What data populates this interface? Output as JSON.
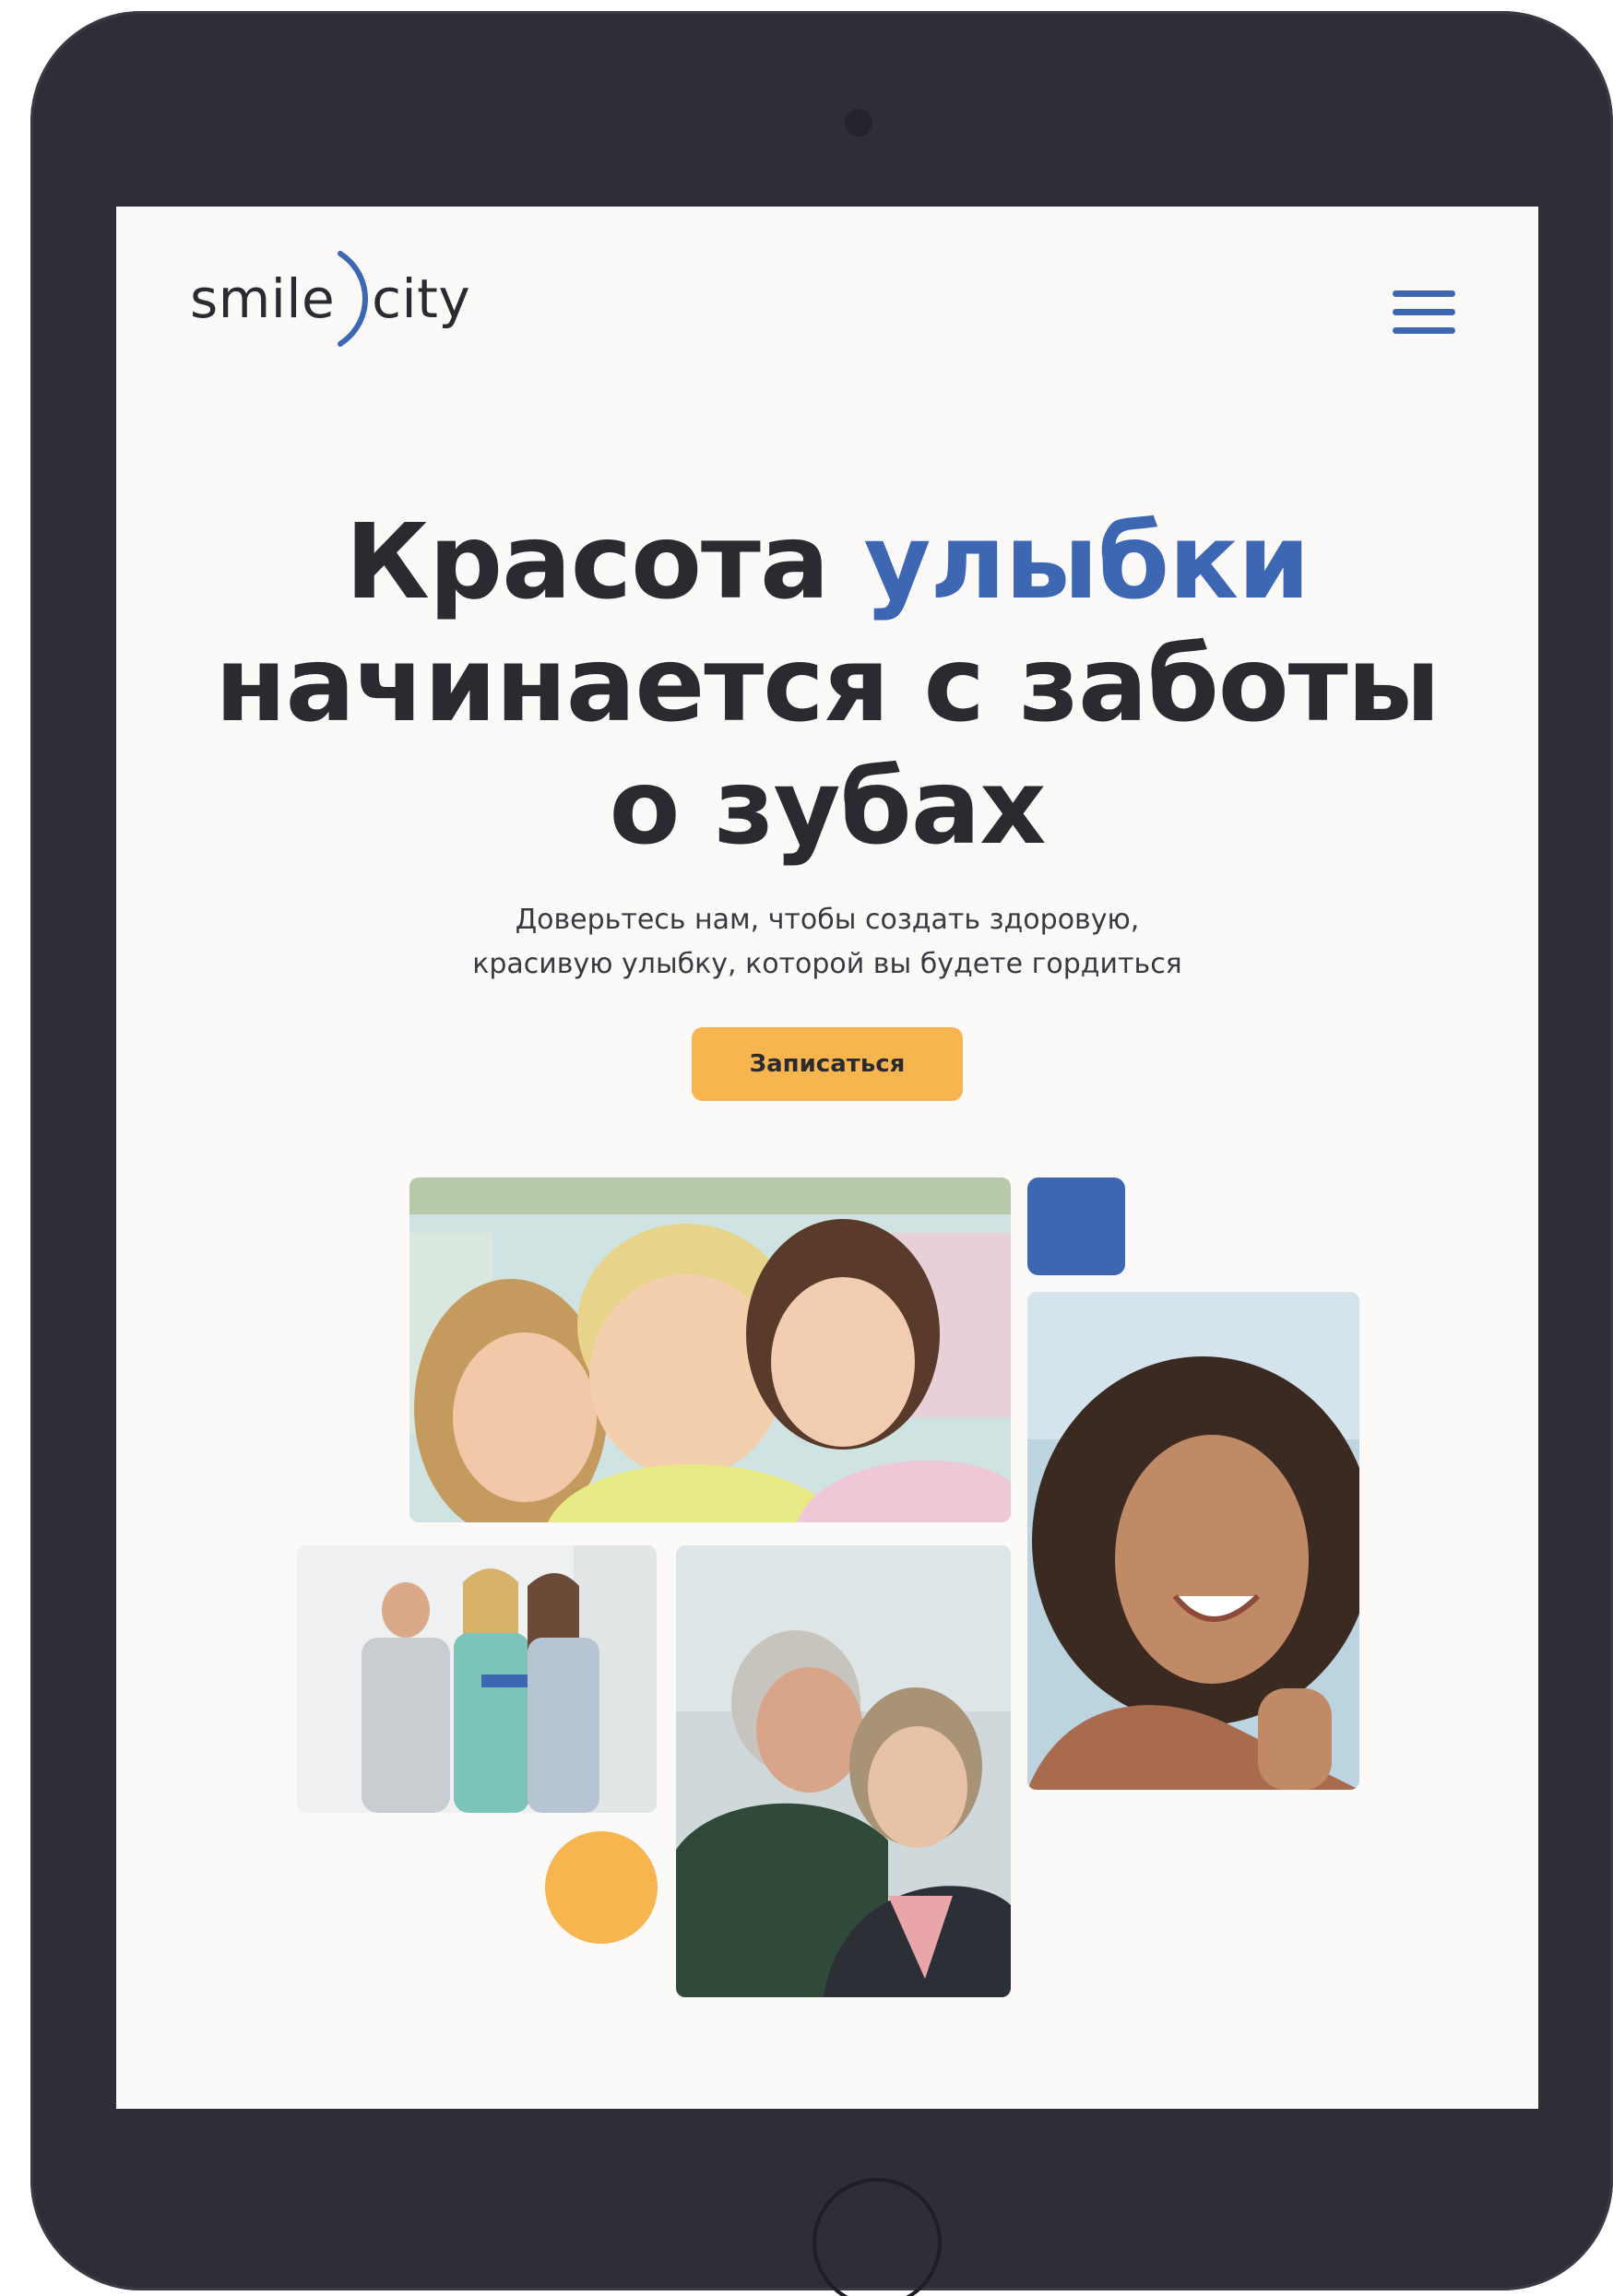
{
  "header": {
    "logo_left": "smile",
    "logo_right": "city",
    "menu_icon": "hamburger-menu-icon"
  },
  "hero": {
    "title_line1_a": "Красота ",
    "title_line1_b": "улыбки",
    "title_line2": "начинается с заботы",
    "title_line3": "о зубах",
    "subtitle_line1": "Доверьтесь нам, чтобы создать здоровую,",
    "subtitle_line2": "красивую улыбку, которой вы будете гордиться",
    "cta_label": "Записаться"
  },
  "colors": {
    "accent_blue": "#3e67b3",
    "accent_orange": "#f6b54f",
    "text_dark": "#2b2a31",
    "screen_bg": "#fbfaf9",
    "device_frame": "#2f2e37"
  }
}
